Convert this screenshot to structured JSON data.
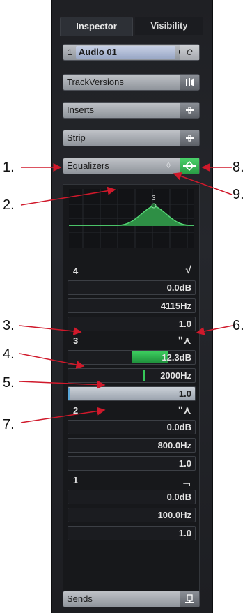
{
  "tabs": {
    "inspector": "Inspector",
    "visibility": "Visibility"
  },
  "track": {
    "number": "1",
    "name": "Audio 01",
    "arrow": "▸",
    "edit_glyph": "e"
  },
  "sections": {
    "trackversions": "TrackVersions",
    "inserts": "Inserts",
    "strip": "Strip",
    "equalizers": "Equalizers",
    "sends": "Sends"
  },
  "curve_label": "3",
  "bands": [
    {
      "number": "4",
      "type_glyph": "√",
      "gain": "0.0dB",
      "freq": "4115Hz",
      "q": "1.0"
    },
    {
      "number": "3",
      "type_glyph": "ʺ⋏",
      "gain": "12.3dB",
      "freq": "2000Hz",
      "q": "1.0"
    },
    {
      "number": "2",
      "type_glyph": "ʺ⋏",
      "gain": "0.0dB",
      "freq": "800.0Hz",
      "q": "1.0"
    },
    {
      "number": "1",
      "type_glyph": "ᆨ",
      "gain": "0.0dB",
      "freq": "100.0Hz",
      "q": "1.0"
    }
  ],
  "annotations": [
    "1.",
    "2.",
    "3.",
    "4.",
    "5.",
    "6.",
    "7.",
    "8.",
    "9."
  ],
  "colors": {
    "accent_green": "#2fae4e",
    "arrow_red": "#d0192b"
  }
}
